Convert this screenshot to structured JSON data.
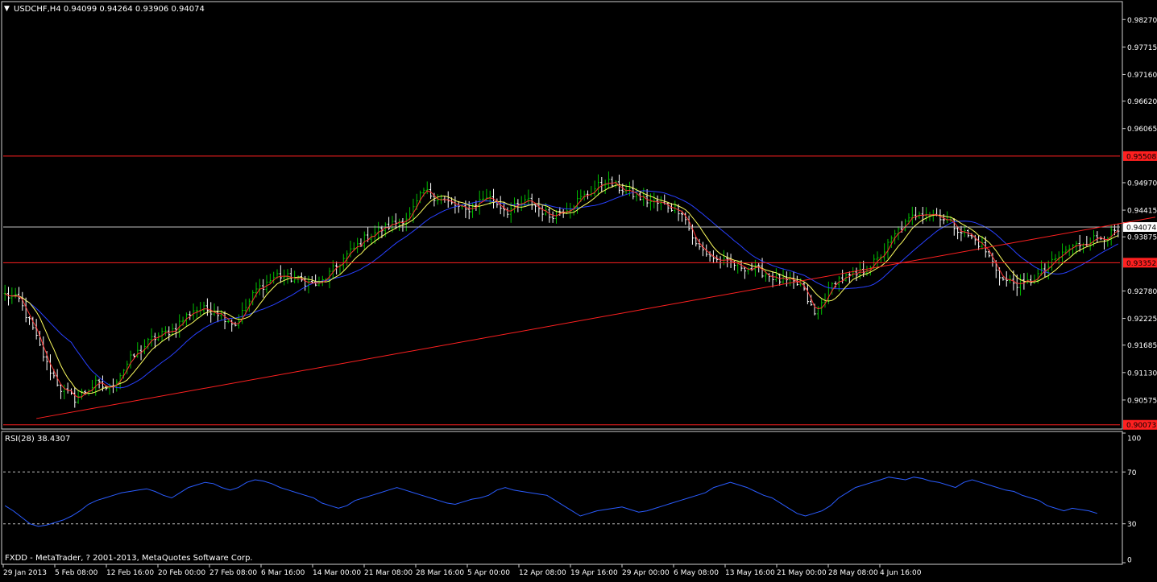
{
  "header": {
    "menu_arrow": "▼",
    "symbol_info": "USDCHF,H4  0.94099 0.94264 0.93906 0.94074"
  },
  "colors": {
    "background": "#000000",
    "frame": "#d0d0d0",
    "bull_bar": "#00c000",
    "bear_bar": "#ffffff",
    "ma_fast": "#ff3030",
    "ma_mid": "#ffff60",
    "ma_slow": "#2840ff",
    "hlines": "#ff2020",
    "current_price": "#c0c0c0",
    "rsi_line": "#2a5cff",
    "text": "#ffffff"
  },
  "chart_data": [
    {
      "type": "line",
      "name": "price-chart",
      "ylim": [
        0.9002,
        0.986
      ],
      "y_ticks": [
        "0.98270",
        "0.97715",
        "0.97160",
        "0.96620",
        "0.96065",
        "0.94970",
        "0.94415",
        "0.93875",
        "0.92780",
        "0.92225",
        "0.91685",
        "0.91130",
        "0.90575"
      ],
      "y_tick_values": [
        0.9827,
        0.97715,
        0.9716,
        0.9662,
        0.96065,
        0.9497,
        0.94415,
        0.93875,
        0.9278,
        0.92225,
        0.91685,
        0.9113,
        0.90575
      ],
      "x_ticks": [
        "29 Jan 2013",
        "5 Feb 08:00",
        "12 Feb 16:00",
        "20 Feb 00:00",
        "27 Feb 08:00",
        "6 Mar 16:00",
        "14 Mar 00:00",
        "21 Mar 08:00",
        "28 Mar 16:00",
        "5 Apr 00:00",
        "12 Apr 08:00",
        "19 Apr 16:00",
        "29 Apr 00:00",
        "6 May 08:00",
        "13 May 16:00",
        "21 May 00:00",
        "28 May 08:00",
        "4 Jun 16:00"
      ],
      "bar_count": 320,
      "close_waypoints": [
        [
          0,
          0.927
        ],
        [
          4,
          0.926
        ],
        [
          8,
          0.92
        ],
        [
          12,
          0.913
        ],
        [
          16,
          0.908
        ],
        [
          20,
          0.906
        ],
        [
          26,
          0.909
        ],
        [
          30,
          0.908
        ],
        [
          36,
          0.914
        ],
        [
          42,
          0.918
        ],
        [
          48,
          0.92
        ],
        [
          54,
          0.924
        ],
        [
          60,
          0.924
        ],
        [
          66,
          0.921
        ],
        [
          72,
          0.928
        ],
        [
          78,
          0.931
        ],
        [
          84,
          0.93
        ],
        [
          90,
          0.929
        ],
        [
          94,
          0.932
        ],
        [
          98,
          0.935
        ],
        [
          104,
          0.939
        ],
        [
          110,
          0.941
        ],
        [
          116,
          0.943
        ],
        [
          120,
          0.948
        ],
        [
          126,
          0.946
        ],
        [
          132,
          0.944
        ],
        [
          138,
          0.947
        ],
        [
          144,
          0.944
        ],
        [
          150,
          0.946
        ],
        [
          156,
          0.943
        ],
        [
          162,
          0.945
        ],
        [
          168,
          0.948
        ],
        [
          172,
          0.95
        ],
        [
          178,
          0.948
        ],
        [
          184,
          0.946
        ],
        [
          190,
          0.945
        ],
        [
          194,
          0.944
        ],
        [
          198,
          0.937
        ],
        [
          204,
          0.934
        ],
        [
          210,
          0.933
        ],
        [
          216,
          0.932
        ],
        [
          222,
          0.93
        ],
        [
          228,
          0.929
        ],
        [
          232,
          0.923
        ],
        [
          238,
          0.93
        ],
        [
          244,
          0.931
        ],
        [
          250,
          0.934
        ],
        [
          256,
          0.94
        ],
        [
          262,
          0.944
        ],
        [
          268,
          0.943
        ],
        [
          274,
          0.94
        ],
        [
          280,
          0.937
        ],
        [
          286,
          0.93
        ],
        [
          292,
          0.929
        ],
        [
          298,
          0.932
        ],
        [
          304,
          0.936
        ],
        [
          310,
          0.938
        ],
        [
          316,
          0.939
        ],
        [
          320,
          0.94
        ]
      ],
      "hlines": [
        {
          "label": "0.95508",
          "value": 0.95508
        },
        {
          "label": "0.93352",
          "value": 0.93352
        },
        {
          "label": "0.90073",
          "value": 0.90073
        }
      ],
      "current_price": {
        "label": "0.94074",
        "value": 0.94074
      },
      "trendline": {
        "from": [
          9,
          0.902
        ],
        "to": [
          320,
          0.9415
        ]
      }
    },
    {
      "type": "line",
      "name": "rsi-indicator",
      "label": "RSI(28) 38.4307",
      "ylim": [
        0,
        100
      ],
      "y_ticks": [
        "100",
        "70",
        "30",
        "0"
      ],
      "y_tick_values": [
        100,
        70,
        30,
        0
      ],
      "levels": [
        70,
        30
      ],
      "series": [
        {
          "name": "RSI(28)",
          "values": [
            44,
            40,
            35,
            30,
            28,
            29,
            31,
            33,
            36,
            40,
            45,
            48,
            50,
            52,
            54,
            55,
            56,
            57,
            55,
            52,
            50,
            54,
            58,
            60,
            62,
            61,
            58,
            56,
            58,
            62,
            64,
            63,
            61,
            58,
            56,
            54,
            52,
            50,
            46,
            44,
            42,
            44,
            48,
            50,
            52,
            54,
            56,
            58,
            56,
            54,
            52,
            50,
            48,
            46,
            45,
            47,
            49,
            50,
            52,
            56,
            58,
            56,
            55,
            54,
            53,
            52,
            48,
            44,
            40,
            36,
            38,
            40,
            41,
            42,
            43,
            41,
            39,
            40,
            42,
            44,
            46,
            48,
            50,
            52,
            54,
            58,
            60,
            62,
            60,
            58,
            55,
            52,
            50,
            46,
            42,
            38,
            36,
            38,
            40,
            44,
            50,
            54,
            58,
            60,
            62,
            64,
            66,
            65,
            64,
            66,
            65,
            63,
            62,
            60,
            58,
            62,
            64,
            62,
            60,
            58,
            56,
            55,
            52,
            50,
            48,
            44,
            42,
            40,
            42,
            41,
            40,
            38
          ]
        }
      ]
    }
  ],
  "footer": {
    "copyright": "FXDD - MetaTrader, ? 2001-2013, MetaQuotes Software Corp."
  }
}
